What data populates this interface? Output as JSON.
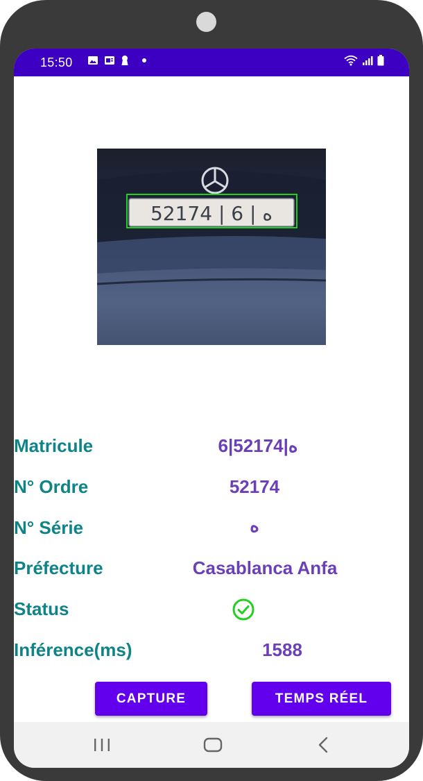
{
  "status_bar": {
    "time": "15:50",
    "left_icons": [
      "image-icon",
      "card-icon",
      "keyhole-icon",
      "dot-icon"
    ],
    "right_icons": [
      "wifi-icon",
      "signal-icon",
      "battery-icon"
    ],
    "background": "#3d00c3"
  },
  "photo": {
    "plate_text": "52174 | ه | 6",
    "detection_box_color": "#22d022"
  },
  "info": {
    "rows": [
      {
        "label": "Matricule",
        "value": "6|ه|52174"
      },
      {
        "label": "N° Ordre",
        "value": "52174"
      },
      {
        "label": "N° Série",
        "value": "ه"
      },
      {
        "label": "Préfecture",
        "value": "Casablanca Anfa"
      },
      {
        "label": "Status",
        "value": ""
      },
      {
        "label": "Inférence(ms)",
        "value": "1588"
      }
    ],
    "status_icon": "check-circle-icon",
    "label_color": "#0e8488",
    "value_color": "#6b3fb8",
    "status_color": "#22d022"
  },
  "buttons": {
    "capture_label": "CAPTURE",
    "realtime_label": "TEMPS RÉEL",
    "color": "#6200ee"
  },
  "nav": {
    "items": [
      "recent-apps-icon",
      "home-icon",
      "back-icon"
    ]
  }
}
